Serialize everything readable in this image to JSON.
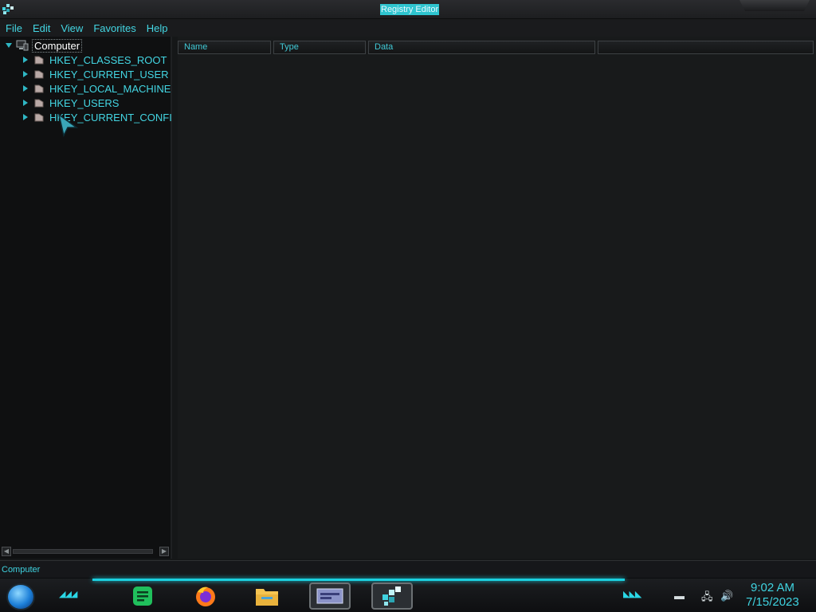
{
  "window": {
    "title": "Registry Editor"
  },
  "menu": {
    "items": [
      "File",
      "Edit",
      "View",
      "Favorites",
      "Help"
    ]
  },
  "tree": {
    "root": "Computer",
    "children": [
      "HKEY_CLASSES_ROOT",
      "HKEY_CURRENT_USER",
      "HKEY_LOCAL_MACHINE",
      "HKEY_USERS",
      "HKEY_CURRENT_CONFI"
    ]
  },
  "list": {
    "columns": [
      "Name",
      "Type",
      "Data",
      ""
    ]
  },
  "status": {
    "text": "Computer"
  },
  "taskbar": {
    "time": "9:02 AM",
    "date": "7/15/2023",
    "pinned": [
      "notes-app",
      "firefox",
      "file-explorer",
      "window-switcher",
      "registry-editor"
    ]
  },
  "colors": {
    "accent": "#3fd3e0",
    "background": "#151718",
    "tree_background": "#0f1011"
  }
}
